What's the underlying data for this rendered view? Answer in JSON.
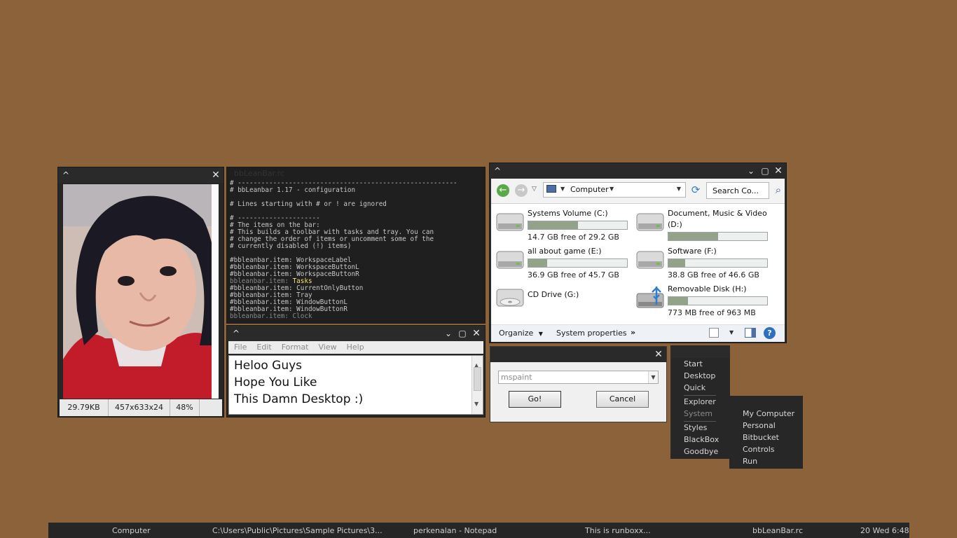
{
  "viewer": {
    "title": "",
    "status": {
      "size": "29.79KB",
      "dims": "457x633x24",
      "zoom": "48%"
    }
  },
  "editor": {
    "title": "bbLeanBar.rc",
    "lines": [
      "# --------------------------------------------------------",
      "# bbLeanbar 1.17 - configuration",
      "",
      "# Lines starting with # or ! are ignored",
      "",
      "# ---------------------",
      "# The items on the bar:",
      "# This builds a toolbar with tasks and tray. You can",
      "# change the order of items or uncomment some of the",
      "# currently disabled (!) items)",
      "",
      "#bbleanbar.item: WorkspaceLabel",
      "#bbleanbar.item: WorkspaceButtonL",
      "#bbleanbar.item: WorkspaceButtonR"
    ],
    "line_tasks_prefix": "bbleanbar.item: ",
    "line_tasks_kw": "Tasks",
    "lines2": [
      "#bbleanbar.item: CurrentOnlyButton",
      "#bbleanbar.item: Tray",
      "#bbleanbar.item: WindowButtonL",
      "#bbleanbar.item: WindowButtonR"
    ],
    "line_last": "bbleanbar.item: Clock"
  },
  "notepad": {
    "menu": [
      "File",
      "Edit",
      "Format",
      "View",
      "Help"
    ],
    "text_lines": [
      "Heloo Guys",
      "Hope You Like",
      "This Damn Desktop :)"
    ]
  },
  "explorer": {
    "address": "Computer",
    "search_placeholder": "Search Co...",
    "drives": [
      {
        "name": "Systems Volume (C:)",
        "free": "14.7 GB free of 29.2 GB",
        "used_fraction": 0.5
      },
      {
        "name": "Document, Music & Video (D:)",
        "free": "",
        "used_fraction": 0.5
      },
      {
        "name": "all about game (E:)",
        "free": "36.9 GB free of 45.7 GB",
        "used_fraction": 0.19
      },
      {
        "name": "Software (F:)",
        "free": "38.8 GB free of 46.6 GB",
        "used_fraction": 0.17
      },
      {
        "name": "CD Drive (G:)",
        "free": ""
      },
      {
        "name": "Removable Disk (H:)",
        "free": "773 MB free of 963 MB",
        "used_fraction": 0.2
      }
    ],
    "cmd": {
      "organize": "Organize",
      "system_properties": "System properties",
      "more": "»"
    }
  },
  "run": {
    "value": "mspaint",
    "ok": "Go!",
    "cancel": "Cancel"
  },
  "menu_root": {
    "items": [
      "Start",
      "Desktop",
      "Quick",
      "Explorer",
      "System",
      "Styles",
      "BlackBox",
      "Goodbye"
    ]
  },
  "menu_system": {
    "items": [
      "My Computer",
      "Personal",
      "Bitbucket",
      "Controls",
      "Run"
    ]
  },
  "taskbar": {
    "tasks": [
      "Computer",
      "C:\\Users\\Public\\Pictures\\Sample Pictures\\3...",
      "perkenalan - Notepad",
      "This is runboxx...",
      "bbLeanBar.rc"
    ],
    "clock": "20 Wed 6:48"
  }
}
